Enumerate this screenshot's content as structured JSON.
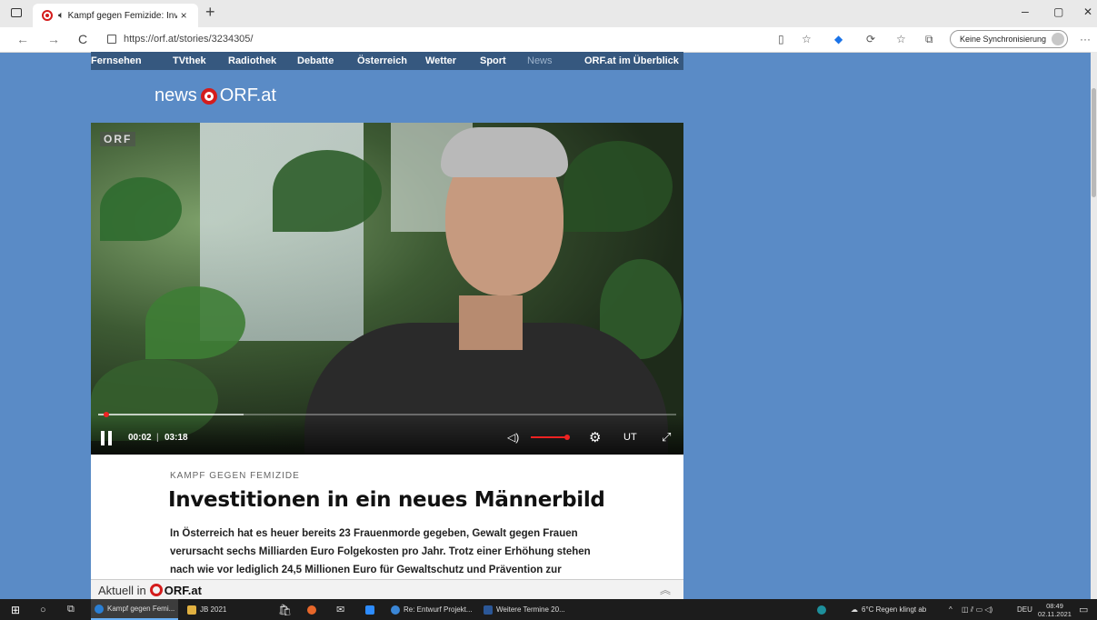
{
  "browser": {
    "tab_title": "Kampf gegen Femizide: Inve",
    "close_tab": "×",
    "new_tab": "+",
    "url": "https://orf.at/stories/3234305/",
    "sync_label": "Keine Synchronisierung",
    "window_controls": {
      "minimize": "–",
      "maximize": "▢",
      "close": "✕"
    },
    "nav": {
      "back": "←",
      "forward": "→",
      "reload": "C"
    },
    "more": "···"
  },
  "site_nav": {
    "items": [
      "Fernsehen",
      "TVthek",
      "Radiothek",
      "Debatte",
      "Österreich",
      "Wetter",
      "Sport",
      "News",
      "ORF.at im Überblick"
    ]
  },
  "logo": {
    "news": "news",
    "orf": "ORF.at"
  },
  "video": {
    "watermark": "ORF",
    "current_time": "00:02",
    "separator": "|",
    "duration": "03:18",
    "progress_fraction": 0.01,
    "subtitles_label": "UT"
  },
  "article": {
    "kicker": "KAMPF GEGEN FEMIZIDE",
    "headline": "Investitionen in ein neues Männerbild",
    "lead": "In Österreich hat es heuer bereits 23 Frauenmorde gegeben, Gewalt gegen Frauen verursacht sechs Milliarden Euro Folgekosten pro Jahr. Trotz einer Erhöhung stehen nach wie vor lediglich 24,5 Millionen Euro für Gewaltschutz und Prävention zur Verfügung – laut"
  },
  "aktuell": {
    "prefix": "Aktuell in",
    "brand": "ORF.at",
    "chevron": "︽"
  },
  "taskbar": {
    "items": [
      {
        "label": "Kampf gegen Femi...",
        "color": "#2a7fd4"
      },
      {
        "label": "JB 2021",
        "color": "#e0b040"
      },
      {
        "label": "Re: Entwurf Projekt...",
        "color": "#3a86d6"
      },
      {
        "label": "Weitere Termine 20...",
        "color": "#2b5797"
      }
    ],
    "weather": "6°C  Regen klingt ab",
    "lang": "DEU",
    "time": "08:49",
    "date": "02.11.2021"
  }
}
